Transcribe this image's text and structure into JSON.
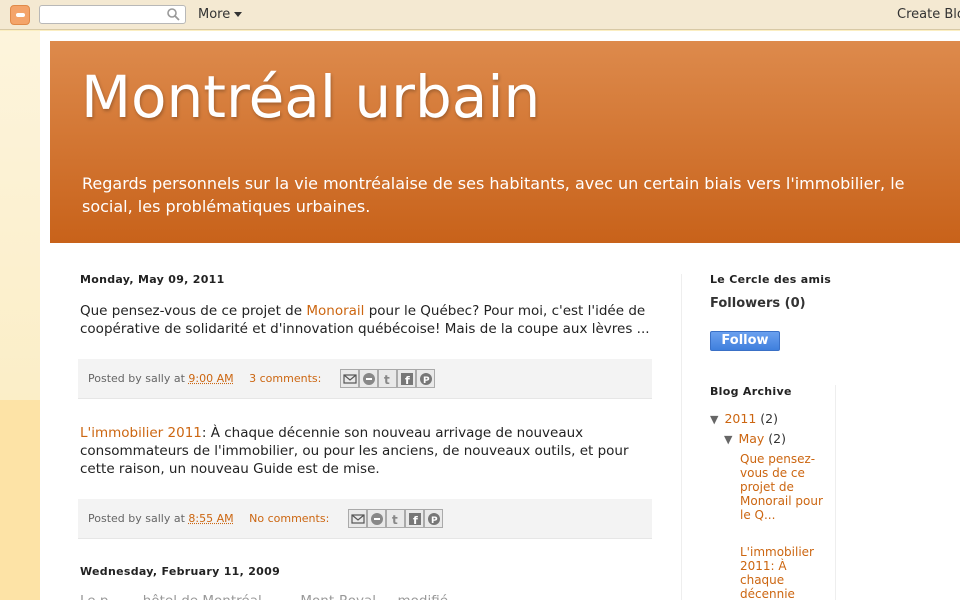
{
  "navbar": {
    "search_placeholder": "",
    "more_label": "More",
    "create_label": "Create Blo"
  },
  "header": {
    "title": "Montréal urbain",
    "description": "Regards personnels sur la vie montréalaise de ses habitants, avec un certain biais vers l'immobilier, le social, les problématiques urbaines."
  },
  "posts": [
    {
      "date": "Monday, May 09, 2011",
      "body_pre": "Que pensez-vous de ce projet de ",
      "body_link": "Monorail",
      "body_post": " pour le Québec? Pour moi, c'est l'idée de coopérative de solidarité et d'innovation québécoise! Mais de la coupe aux lèvres ...",
      "posted_by": "Posted by sally at ",
      "time": "9:00 AM",
      "comments": "3 comments:"
    },
    {
      "date": "",
      "body_link": "L'immobilier 2011",
      "body_post": ": À chaque décennie son nouveau arrivage de nouveaux consommateurs de l'immobilier, ou pour les anciens, de nouveaux outils, et pour cette raison, un nouveau Guide est de mise.",
      "posted_by": "Posted by sally at ",
      "time": "8:55 AM",
      "comments": "No comments:"
    },
    {
      "date": "Wednesday, February 11, 2009",
      "body_partial": "Le p...  ...  hôtel de Montréal ...  ... Mont-Royal ... modifié..."
    }
  ],
  "sidebar": {
    "followers_heading": "Le Cercle des amis",
    "followers_count": "Followers (0)",
    "follow_button": "Follow",
    "archive_heading": "Blog Archive",
    "year": "2011",
    "year_count": "(2)",
    "month": "May",
    "month_count": "(2)",
    "archive_posts": [
      "Que pensez-vous de ce projet de Monorail pour le Q...",
      "L'immobilier 2011: À chaque décennie"
    ]
  },
  "share_icons": [
    "email-icon",
    "blogger-icon",
    "twitter-icon",
    "facebook-icon",
    "pinterest-icon"
  ]
}
